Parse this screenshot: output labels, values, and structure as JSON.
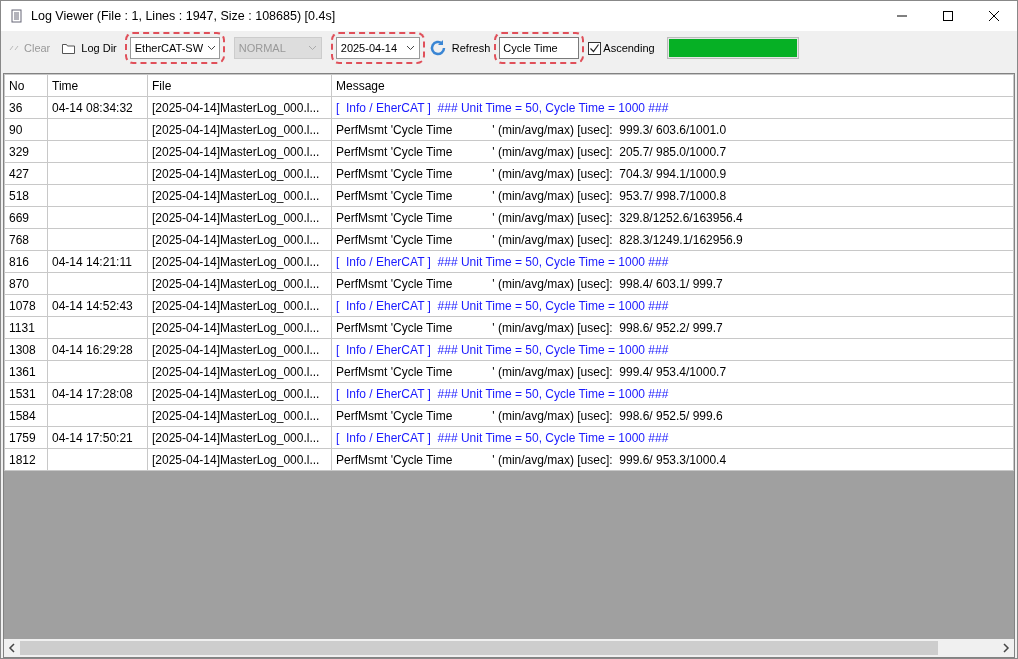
{
  "window": {
    "title": "Log Viewer (File : 1, Lines : 1947, Size : 108685) [0.4s]"
  },
  "toolbar": {
    "clear": {
      "label": "Clear",
      "disabled": true
    },
    "log_dir": {
      "label": "Log Dir"
    },
    "source_select": {
      "value": "EtherCAT-SW",
      "highlighted": true
    },
    "level_select": {
      "value": "NORMAL",
      "disabled": true,
      "highlighted": false
    },
    "date_select": {
      "value": "2025-04-14",
      "highlighted": true
    },
    "refresh": {
      "label": "Refresh"
    },
    "filter": {
      "value": "Cycle Time",
      "highlighted": true
    },
    "ascending": {
      "label": "Ascending",
      "checked": true
    },
    "progress": {
      "level": 1
    }
  },
  "table": {
    "columns": [
      "No",
      "Time",
      "File",
      "Message"
    ],
    "rows": [
      {
        "kind": "info",
        "no": "36",
        "time": "04-14 08:34:32",
        "file": "[2025-04-14]MasterLog_000.l...",
        "message": "[  Info / EherCAT ]  ### Unit Time = 50, Cycle Time = 1000 ###"
      },
      {
        "kind": "perf",
        "no": "90",
        "file": "[2025-04-14]MasterLog_000.l...",
        "message": "PerfMsmt 'Cycle Time            ' (min/avg/max) [usec]:  999.3/ 603.6/1001.0"
      },
      {
        "kind": "perf",
        "no": "329",
        "file": "[2025-04-14]MasterLog_000.l...",
        "message": "PerfMsmt 'Cycle Time            ' (min/avg/max) [usec]:  205.7/ 985.0/1000.7"
      },
      {
        "kind": "perf",
        "no": "427",
        "file": "[2025-04-14]MasterLog_000.l...",
        "message": "PerfMsmt 'Cycle Time            ' (min/avg/max) [usec]:  704.3/ 994.1/1000.9"
      },
      {
        "kind": "perf",
        "no": "518",
        "file": "[2025-04-14]MasterLog_000.l...",
        "message": "PerfMsmt 'Cycle Time            ' (min/avg/max) [usec]:  953.7/ 998.7/1000.8"
      },
      {
        "kind": "perf",
        "no": "669",
        "file": "[2025-04-14]MasterLog_000.l...",
        "message": "PerfMsmt 'Cycle Time            ' (min/avg/max) [usec]:  329.8/1252.6/163956.4"
      },
      {
        "kind": "perf",
        "no": "768",
        "file": "[2025-04-14]MasterLog_000.l...",
        "message": "PerfMsmt 'Cycle Time            ' (min/avg/max) [usec]:  828.3/1249.1/162956.9"
      },
      {
        "kind": "info",
        "no": "816",
        "time": "04-14 14:21:11",
        "file": "[2025-04-14]MasterLog_000.l...",
        "message": "[  Info / EherCAT ]  ### Unit Time = 50, Cycle Time = 1000 ###"
      },
      {
        "kind": "perf",
        "no": "870",
        "file": "[2025-04-14]MasterLog_000.l...",
        "message": "PerfMsmt 'Cycle Time            ' (min/avg/max) [usec]:  998.4/ 603.1/ 999.7"
      },
      {
        "kind": "info",
        "no": "1078",
        "time": "04-14 14:52:43",
        "file": "[2025-04-14]MasterLog_000.l...",
        "message": "[  Info / EherCAT ]  ### Unit Time = 50, Cycle Time = 1000 ###"
      },
      {
        "kind": "perf",
        "no": "1131",
        "file": "[2025-04-14]MasterLog_000.l...",
        "message": "PerfMsmt 'Cycle Time            ' (min/avg/max) [usec]:  998.6/ 952.2/ 999.7"
      },
      {
        "kind": "info",
        "no": "1308",
        "time": "04-14 16:29:28",
        "file": "[2025-04-14]MasterLog_000.l...",
        "message": "[  Info / EherCAT ]  ### Unit Time = 50, Cycle Time = 1000 ###"
      },
      {
        "kind": "perf",
        "no": "1361",
        "file": "[2025-04-14]MasterLog_000.l...",
        "message": "PerfMsmt 'Cycle Time            ' (min/avg/max) [usec]:  999.4/ 953.4/1000.7"
      },
      {
        "kind": "info",
        "no": "1531",
        "time": "04-14 17:28:08",
        "file": "[2025-04-14]MasterLog_000.l...",
        "message": "[  Info / EherCAT ]  ### Unit Time = 50, Cycle Time = 1000 ###"
      },
      {
        "kind": "perf",
        "no": "1584",
        "file": "[2025-04-14]MasterLog_000.l...",
        "message": "PerfMsmt 'Cycle Time            ' (min/avg/max) [usec]:  998.6/ 952.5/ 999.6"
      },
      {
        "kind": "info",
        "no": "1759",
        "time": "04-14 17:50:21",
        "file": "[2025-04-14]MasterLog_000.l...",
        "message": "[  Info / EherCAT ]  ### Unit Time = 50, Cycle Time = 1000 ###"
      },
      {
        "kind": "perf",
        "no": "1812",
        "file": "[2025-04-14]MasterLog_000.l...",
        "message": "PerfMsmt 'Cycle Time            ' (min/avg/max) [usec]:  999.6/ 953.3/1000.4"
      }
    ]
  }
}
